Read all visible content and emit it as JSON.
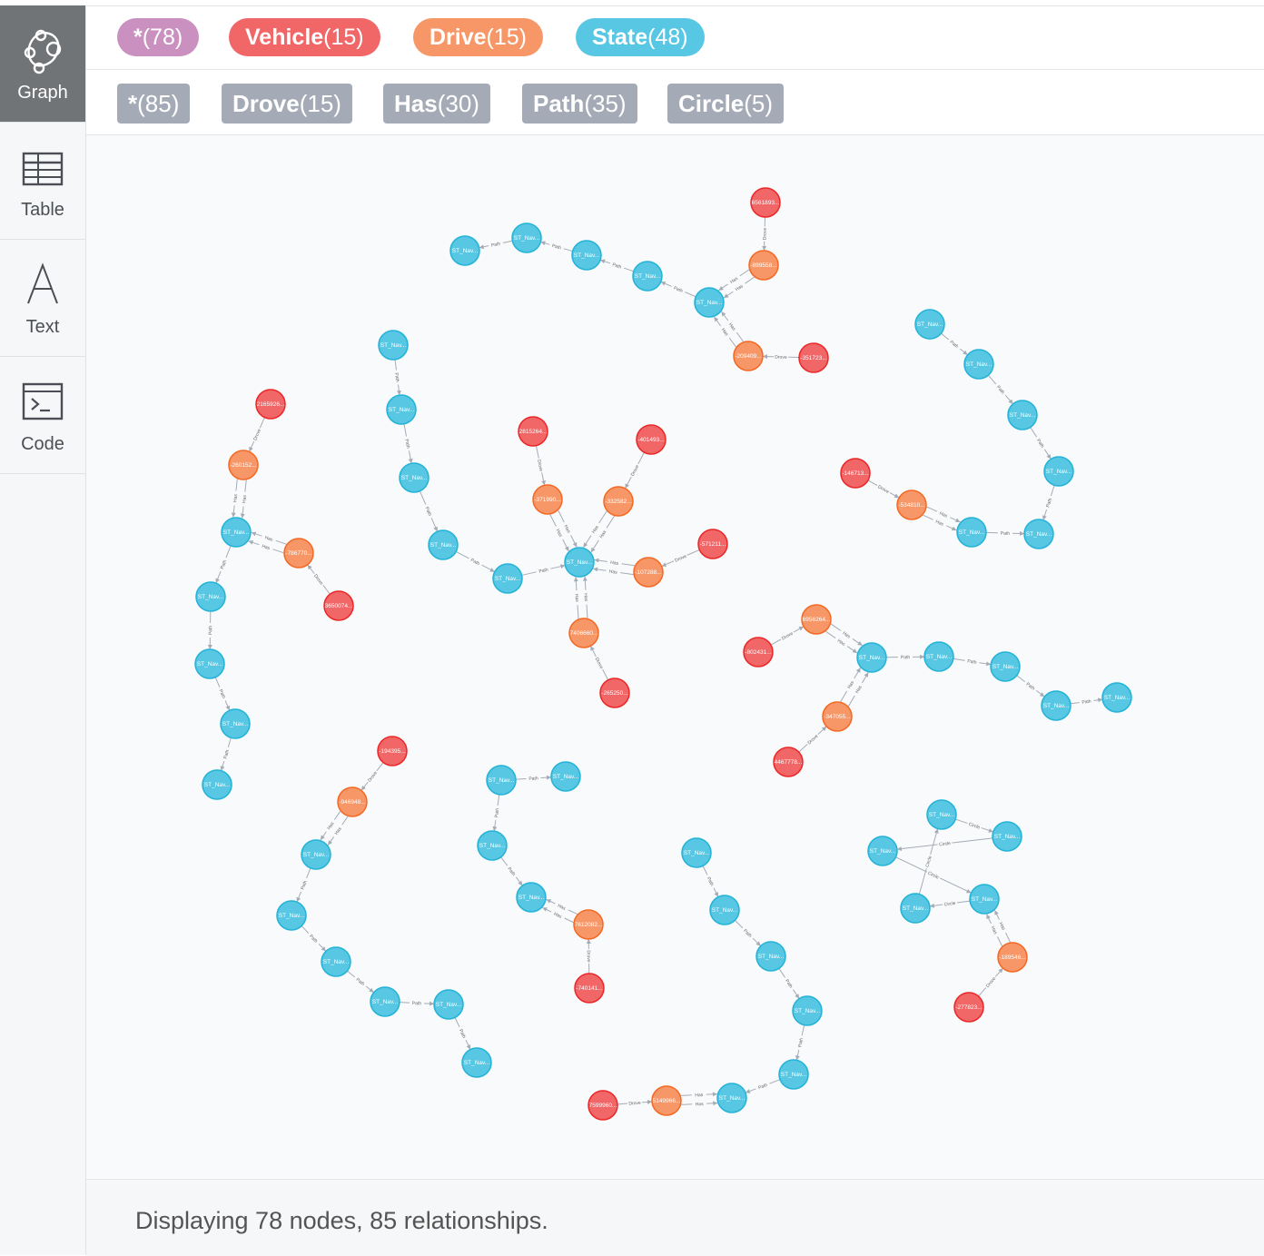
{
  "sidebar": {
    "items": [
      {
        "label": "Graph",
        "icon": "graph-icon",
        "active": true
      },
      {
        "label": "Table",
        "icon": "table-icon",
        "active": false
      },
      {
        "label": "Text",
        "icon": "text-icon",
        "active": false
      },
      {
        "label": "Code",
        "icon": "code-icon",
        "active": false
      }
    ]
  },
  "node_labels": [
    {
      "name": "*",
      "count": "(78)",
      "color": "#c990c0"
    },
    {
      "name": "Vehicle",
      "count": "(15)",
      "color": "#f16667"
    },
    {
      "name": "Drive",
      "count": "(15)",
      "color": "#f79767"
    },
    {
      "name": "State",
      "count": "(48)",
      "color": "#57c7e3"
    }
  ],
  "relationship_types": [
    {
      "name": "*",
      "count": "(85)"
    },
    {
      "name": "Drove",
      "count": "(15)"
    },
    {
      "name": "Has",
      "count": "(30)"
    },
    {
      "name": "Path",
      "count": "(35)"
    },
    {
      "name": "Circle",
      "count": "(5)"
    }
  ],
  "graph": {
    "colors": {
      "Vehicle": "#f16667",
      "Drive": "#f79767",
      "State": "#57c7e3"
    },
    "nodes": [
      {
        "id": "v1",
        "type": "Vehicle",
        "label": "6561893..."
      },
      {
        "id": "d1",
        "type": "Drive",
        "label": "-899558..."
      },
      {
        "id": "s1",
        "type": "State",
        "label": "ST_Nav..."
      },
      {
        "id": "s2",
        "type": "State",
        "label": "ST_Nav..."
      },
      {
        "id": "s3",
        "type": "State",
        "label": "ST_Nav..."
      },
      {
        "id": "s4",
        "type": "State",
        "label": "ST_Nav..."
      },
      {
        "id": "s5",
        "type": "State",
        "label": "ST_Nav..."
      },
      {
        "id": "d2",
        "type": "Drive",
        "label": "-209409..."
      },
      {
        "id": "v2",
        "type": "Vehicle",
        "label": "-351723..."
      },
      {
        "id": "v3",
        "type": "Vehicle",
        "label": "2165926..."
      },
      {
        "id": "d3",
        "type": "Drive",
        "label": "-260152..."
      },
      {
        "id": "s6",
        "type": "State",
        "label": "ST_Nav..."
      },
      {
        "id": "d4",
        "type": "Drive",
        "label": "-786770..."
      },
      {
        "id": "v4",
        "type": "Vehicle",
        "label": "3650074..."
      },
      {
        "id": "s7",
        "type": "State",
        "label": "ST_Nav..."
      },
      {
        "id": "s8",
        "type": "State",
        "label": "ST_Nav..."
      },
      {
        "id": "s9",
        "type": "State",
        "label": "ST_Nav..."
      },
      {
        "id": "s10",
        "type": "State",
        "label": "ST_Nav..."
      },
      {
        "id": "s11",
        "type": "State",
        "label": "ST_Nav..."
      },
      {
        "id": "s12",
        "type": "State",
        "label": "ST_Nav..."
      },
      {
        "id": "s13",
        "type": "State",
        "label": "ST_Nav..."
      },
      {
        "id": "s14",
        "type": "State",
        "label": "ST_Nav..."
      },
      {
        "id": "s15",
        "type": "State",
        "label": "ST_Nav..."
      },
      {
        "id": "s16",
        "type": "State",
        "label": "ST_Nav..."
      },
      {
        "id": "v5",
        "type": "Vehicle",
        "label": "2815264..."
      },
      {
        "id": "d5",
        "type": "Drive",
        "label": "-371990..."
      },
      {
        "id": "v6",
        "type": "Vehicle",
        "label": "-401493..."
      },
      {
        "id": "d6",
        "type": "Drive",
        "label": "-332582..."
      },
      {
        "id": "v7",
        "type": "Vehicle",
        "label": "-571211..."
      },
      {
        "id": "d7",
        "type": "Drive",
        "label": "-107288..."
      },
      {
        "id": "d8",
        "type": "Drive",
        "label": "7406660..."
      },
      {
        "id": "v8",
        "type": "Vehicle",
        "label": "-265250..."
      },
      {
        "id": "s17",
        "type": "State",
        "label": "ST_Nav..."
      },
      {
        "id": "s18",
        "type": "State",
        "label": "ST_Nav..."
      },
      {
        "id": "s19",
        "type": "State",
        "label": "ST_Nav..."
      },
      {
        "id": "s20",
        "type": "State",
        "label": "ST_Nav..."
      },
      {
        "id": "s21",
        "type": "State",
        "label": "ST_Nav..."
      },
      {
        "id": "v9",
        "type": "Vehicle",
        "label": "-146713..."
      },
      {
        "id": "d9",
        "type": "Drive",
        "label": "-534810..."
      },
      {
        "id": "s22",
        "type": "State",
        "label": "ST_Nav..."
      },
      {
        "id": "s23",
        "type": "State",
        "label": "ST_Nav..."
      },
      {
        "id": "s24",
        "type": "State",
        "label": "ST_Nav..."
      },
      {
        "id": "d10",
        "type": "Drive",
        "label": "6956264..."
      },
      {
        "id": "v10",
        "type": "Vehicle",
        "label": "-802431..."
      },
      {
        "id": "s25",
        "type": "State",
        "label": "ST_Nav..."
      },
      {
        "id": "s26",
        "type": "State",
        "label": "ST_Nav..."
      },
      {
        "id": "s27",
        "type": "State",
        "label": "ST_Nav..."
      },
      {
        "id": "s28",
        "type": "State",
        "label": "ST_Nav..."
      },
      {
        "id": "s29",
        "type": "State",
        "label": "ST_Nav..."
      },
      {
        "id": "d11",
        "type": "Drive",
        "label": "-347055..."
      },
      {
        "id": "v11",
        "type": "Vehicle",
        "label": "4467778..."
      },
      {
        "id": "v12",
        "type": "Vehicle",
        "label": "-194395..."
      },
      {
        "id": "d12",
        "type": "Drive",
        "label": "-946948..."
      },
      {
        "id": "s30",
        "type": "State",
        "label": "ST_Nav..."
      },
      {
        "id": "s31",
        "type": "State",
        "label": "ST_Nav..."
      },
      {
        "id": "s32",
        "type": "State",
        "label": "ST_Nav..."
      },
      {
        "id": "s33",
        "type": "State",
        "label": "ST_Nav..."
      },
      {
        "id": "s34",
        "type": "State",
        "label": "ST_Nav..."
      },
      {
        "id": "s35",
        "type": "State",
        "label": "ST_Nav..."
      },
      {
        "id": "s36",
        "type": "State",
        "label": "ST_Nav..."
      },
      {
        "id": "s37",
        "type": "State",
        "label": "ST_Nav..."
      },
      {
        "id": "s38",
        "type": "State",
        "label": "ST_Nav..."
      },
      {
        "id": "s39",
        "type": "State",
        "label": "ST_Nav..."
      },
      {
        "id": "d13",
        "type": "Drive",
        "label": "7612082..."
      },
      {
        "id": "v13",
        "type": "Vehicle",
        "label": "-740141..."
      },
      {
        "id": "s40",
        "type": "State",
        "label": "ST_Nav..."
      },
      {
        "id": "s41",
        "type": "State",
        "label": "ST_Nav..."
      },
      {
        "id": "s42",
        "type": "State",
        "label": "ST_Nav..."
      },
      {
        "id": "s43",
        "type": "State",
        "label": "ST_Nav..."
      },
      {
        "id": "s44",
        "type": "State",
        "label": "ST_Nav..."
      },
      {
        "id": "s45",
        "type": "State",
        "label": "ST_Nav..."
      },
      {
        "id": "d14",
        "type": "Drive",
        "label": "5149966..."
      },
      {
        "id": "v14",
        "type": "Vehicle",
        "label": "7599960..."
      },
      {
        "id": "s46",
        "type": "State",
        "label": "ST_Nav..."
      },
      {
        "id": "s47",
        "type": "State",
        "label": "ST_Nav..."
      },
      {
        "id": "s48",
        "type": "State",
        "label": "ST_Nav..."
      },
      {
        "id": "s49",
        "type": "State",
        "label": "ST_Nav..."
      },
      {
        "id": "s50",
        "type": "State",
        "label": "ST_Nav..."
      },
      {
        "id": "d15",
        "type": "Drive",
        "label": "-189546..."
      },
      {
        "id": "v15",
        "type": "Vehicle",
        "label": "-277823..."
      }
    ],
    "edges": [
      {
        "from": "v1",
        "to": "d1",
        "type": "Drove"
      },
      {
        "from": "d1",
        "to": "s1",
        "type": "Has"
      },
      {
        "from": "d1",
        "to": "s1",
        "type": "Has"
      },
      {
        "from": "s1",
        "to": "s2",
        "type": "Path"
      },
      {
        "from": "s2",
        "to": "s3",
        "type": "Path"
      },
      {
        "from": "s3",
        "to": "s4",
        "type": "Path"
      },
      {
        "from": "s4",
        "to": "s5",
        "type": "Path"
      },
      {
        "from": "d2",
        "to": "s1",
        "type": "Has"
      },
      {
        "from": "d2",
        "to": "s1",
        "type": "Has"
      },
      {
        "from": "v2",
        "to": "d2",
        "type": "Drove"
      },
      {
        "from": "v3",
        "to": "d3",
        "type": "Drove"
      },
      {
        "from": "d3",
        "to": "s6",
        "type": "Has"
      },
      {
        "from": "d3",
        "to": "s6",
        "type": "Has"
      },
      {
        "from": "d4",
        "to": "s6",
        "type": "Has"
      },
      {
        "from": "d4",
        "to": "s6",
        "type": "Has"
      },
      {
        "from": "v4",
        "to": "d4",
        "type": "Drove"
      },
      {
        "from": "s6",
        "to": "s7",
        "type": "Path"
      },
      {
        "from": "s7",
        "to": "s8",
        "type": "Path"
      },
      {
        "from": "s8",
        "to": "s9",
        "type": "Path"
      },
      {
        "from": "s9",
        "to": "s10",
        "type": "Path"
      },
      {
        "from": "s11",
        "to": "s12",
        "type": "Path"
      },
      {
        "from": "s12",
        "to": "s13",
        "type": "Path"
      },
      {
        "from": "s13",
        "to": "s14",
        "type": "Path"
      },
      {
        "from": "s14",
        "to": "s15",
        "type": "Path"
      },
      {
        "from": "s15",
        "to": "s16",
        "type": "Path"
      },
      {
        "from": "s16",
        "to": "s17",
        "type": "Path"
      },
      {
        "from": "v5",
        "to": "d5",
        "type": "Drove"
      },
      {
        "from": "d5",
        "to": "s17",
        "type": "Has"
      },
      {
        "from": "d5",
        "to": "s17",
        "type": "Has"
      },
      {
        "from": "v6",
        "to": "d6",
        "type": "Drove"
      },
      {
        "from": "d6",
        "to": "s17",
        "type": "Has"
      },
      {
        "from": "d6",
        "to": "s17",
        "type": "Has"
      },
      {
        "from": "v7",
        "to": "d7",
        "type": "Drove"
      },
      {
        "from": "d7",
        "to": "s17",
        "type": "Has"
      },
      {
        "from": "d7",
        "to": "s17",
        "type": "Has"
      },
      {
        "from": "d8",
        "to": "s17",
        "type": "Has"
      },
      {
        "from": "d8",
        "to": "s17",
        "type": "Has"
      },
      {
        "from": "v8",
        "to": "d8",
        "type": "Drove"
      },
      {
        "from": "s18",
        "to": "s19",
        "type": "Path"
      },
      {
        "from": "s19",
        "to": "s20",
        "type": "Path"
      },
      {
        "from": "s20",
        "to": "s21",
        "type": "Path"
      },
      {
        "from": "s21",
        "to": "s22",
        "type": "Path"
      },
      {
        "from": "v9",
        "to": "d9",
        "type": "Drove"
      },
      {
        "from": "d9",
        "to": "s23",
        "type": "Has"
      },
      {
        "from": "d9",
        "to": "s23",
        "type": "Has"
      },
      {
        "from": "s23",
        "to": "s22",
        "type": "Path"
      },
      {
        "from": "v10",
        "to": "d10",
        "type": "Drove"
      },
      {
        "from": "d10",
        "to": "s25",
        "type": "Has"
      },
      {
        "from": "d10",
        "to": "s25",
        "type": "Has"
      },
      {
        "from": "s25",
        "to": "s26",
        "type": "Path"
      },
      {
        "from": "s26",
        "to": "s27",
        "type": "Path"
      },
      {
        "from": "s27",
        "to": "s28",
        "type": "Path"
      },
      {
        "from": "s28",
        "to": "s29",
        "type": "Path"
      },
      {
        "from": "d11",
        "to": "s25",
        "type": "Has"
      },
      {
        "from": "d11",
        "to": "s25",
        "type": "Has"
      },
      {
        "from": "v11",
        "to": "d11",
        "type": "Drove"
      },
      {
        "from": "v12",
        "to": "d12",
        "type": "Drove"
      },
      {
        "from": "d12",
        "to": "s30",
        "type": "Has"
      },
      {
        "from": "d12",
        "to": "s30",
        "type": "Has"
      },
      {
        "from": "s30",
        "to": "s31",
        "type": "Path"
      },
      {
        "from": "s31",
        "to": "s32",
        "type": "Path"
      },
      {
        "from": "s32",
        "to": "s33",
        "type": "Path"
      },
      {
        "from": "s33",
        "to": "s34",
        "type": "Path"
      },
      {
        "from": "s34",
        "to": "s35",
        "type": "Path"
      },
      {
        "from": "s36",
        "to": "s37",
        "type": "Path"
      },
      {
        "from": "s36",
        "to": "s38",
        "type": "Path"
      },
      {
        "from": "s38",
        "to": "s39",
        "type": "Path"
      },
      {
        "from": "d13",
        "to": "s39",
        "type": "Has"
      },
      {
        "from": "d13",
        "to": "s39",
        "type": "Has"
      },
      {
        "from": "v13",
        "to": "d13",
        "type": "Drove"
      },
      {
        "from": "s40",
        "to": "s41",
        "type": "Path"
      },
      {
        "from": "s41",
        "to": "s42",
        "type": "Path"
      },
      {
        "from": "s42",
        "to": "s43",
        "type": "Path"
      },
      {
        "from": "s43",
        "to": "s44",
        "type": "Path"
      },
      {
        "from": "s44",
        "to": "s45",
        "type": "Path"
      },
      {
        "from": "v14",
        "to": "d14",
        "type": "Drove"
      },
      {
        "from": "d14",
        "to": "s45",
        "type": "Has"
      },
      {
        "from": "d14",
        "to": "s45",
        "type": "Has"
      },
      {
        "from": "s46",
        "to": "s47",
        "type": "Circle"
      },
      {
        "from": "s47",
        "to": "s48",
        "type": "Circle"
      },
      {
        "from": "s48",
        "to": "s49",
        "type": "Circle"
      },
      {
        "from": "s49",
        "to": "s50",
        "type": "Circle"
      },
      {
        "from": "s50",
        "to": "s46",
        "type": "Circle"
      },
      {
        "from": "d15",
        "to": "s49",
        "type": "Has"
      },
      {
        "from": "d15",
        "to": "s49",
        "type": "Has"
      },
      {
        "from": "v15",
        "to": "d15",
        "type": "Drove"
      }
    ]
  },
  "footer": {
    "status": "Displaying 78 nodes, 85 relationships."
  }
}
